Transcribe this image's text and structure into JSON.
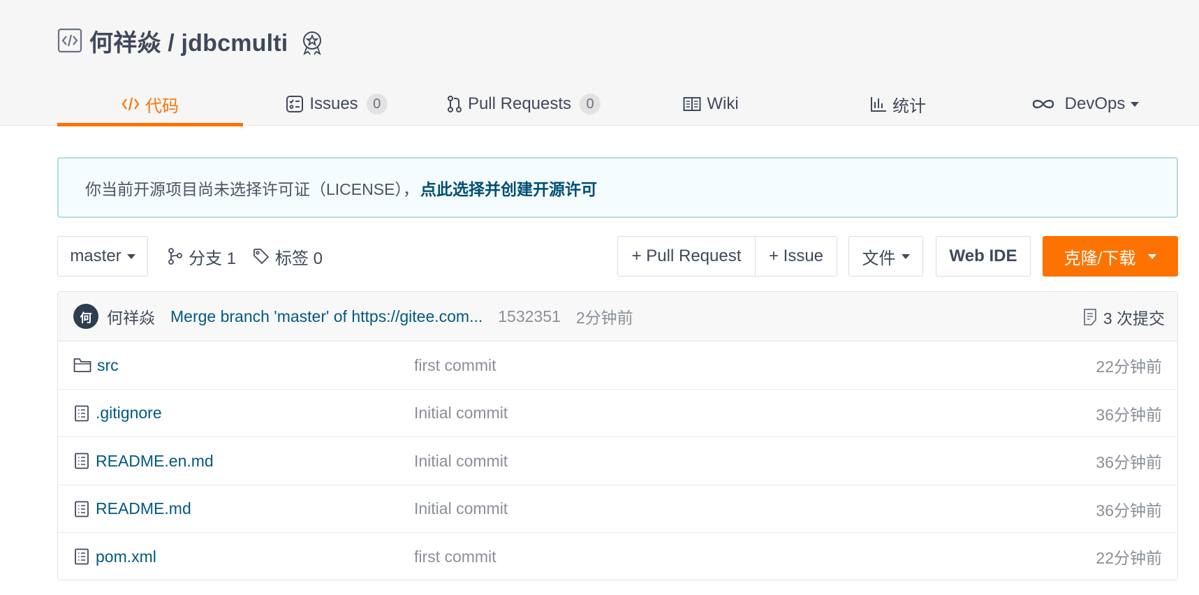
{
  "repo": {
    "title": "何祥焱 / jdbcmulti"
  },
  "tabs": [
    {
      "label": "代码",
      "icon": "code-icon",
      "count": null
    },
    {
      "label": "Issues",
      "icon": "issues-icon",
      "count": "0"
    },
    {
      "label": "Pull Requests",
      "icon": "pull-request-icon",
      "count": "0"
    },
    {
      "label": "Wiki",
      "icon": "book-icon",
      "count": null
    },
    {
      "label": "统计",
      "icon": "bar-chart-icon",
      "count": null
    },
    {
      "label": "DevOps",
      "icon": "infinity-icon",
      "count": null
    }
  ],
  "notice": {
    "text": "你当前开源项目尚未选择许可证（LICENSE），",
    "link": "点此选择并创建开源许可"
  },
  "toolbar": {
    "branch": "master",
    "branches": "分支 1",
    "tags": "标签 0",
    "pull_request": "+ Pull Request",
    "issue": "+ Issue",
    "file": "文件",
    "web_ide": "Web IDE",
    "clone": "克隆/下载"
  },
  "commit": {
    "avatar": "何",
    "author": "何祥焱",
    "message": "Merge branch 'master' of https://gitee.com...",
    "hash": "1532351",
    "time": "2分钟前",
    "count": "3 次提交"
  },
  "files": [
    {
      "name": "src",
      "type": "folder",
      "message": "first commit",
      "time": "22分钟前"
    },
    {
      "name": ".gitignore",
      "type": "file",
      "message": "Initial commit",
      "time": "36分钟前"
    },
    {
      "name": "README.en.md",
      "type": "file",
      "message": "Initial commit",
      "time": "36分钟前"
    },
    {
      "name": "README.md",
      "type": "file",
      "message": "Initial commit",
      "time": "36分钟前"
    },
    {
      "name": "pom.xml",
      "type": "file",
      "message": "first commit",
      "time": "22分钟前"
    }
  ],
  "colors": {
    "accent": "#fe7300",
    "link": "#005980",
    "notice_border": "#b6dde2"
  }
}
